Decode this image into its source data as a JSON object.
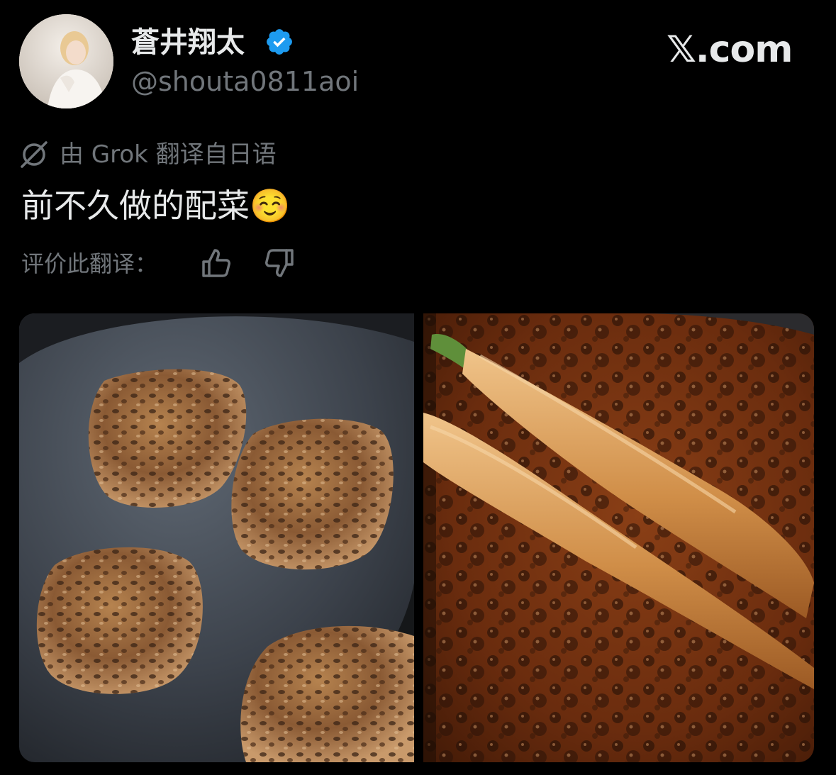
{
  "header": {
    "display_name": "蒼井翔太",
    "handle": "@shouta0811aoi",
    "brand": "𝕏.com"
  },
  "translation": {
    "note": "由 Grok 翻译自日语",
    "rate_label": "评价此翻译："
  },
  "post": {
    "text": "前不久做的配菜☺️"
  },
  "colors": {
    "background": "#000000",
    "primary_text": "#e7e9ea",
    "secondary_text": "#71767b",
    "verified_blue": "#1d9bf0"
  },
  "icons": {
    "verified": "verified-badge-icon",
    "grok": "grok-icon",
    "thumbs_up": "thumbs-up-icon",
    "thumbs_down": "thumbs-down-icon"
  }
}
